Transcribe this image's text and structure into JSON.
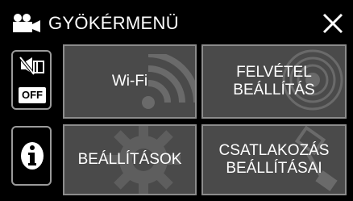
{
  "header": {
    "title": "GYÖKÉRMENÜ",
    "camera_icon": "video-camera-icon",
    "close_icon": "close-icon"
  },
  "side": {
    "mute": {
      "icon": "sound-off-icon",
      "badge": "OFF"
    },
    "info": {
      "icon": "info-icon"
    }
  },
  "tiles": [
    {
      "line1": "Wi-Fi",
      "line2": "",
      "icon": "wifi-icon"
    },
    {
      "line1": "FELVÉTEL",
      "line2": "BEÁLLÍTÁS",
      "icon": "record-target-icon"
    },
    {
      "line1": "BEÁLLÍTÁSOK",
      "line2": "",
      "icon": "gear-icon"
    },
    {
      "line1": "CSATLAKOZÁS",
      "line2": "BEÁLLÍTÁSAI",
      "icon": "connect-icon"
    }
  ],
  "colors": {
    "background": "#000000",
    "tile": "#4a4a4a",
    "tile_border": "#8c8c8c",
    "text": "#ffffff"
  }
}
